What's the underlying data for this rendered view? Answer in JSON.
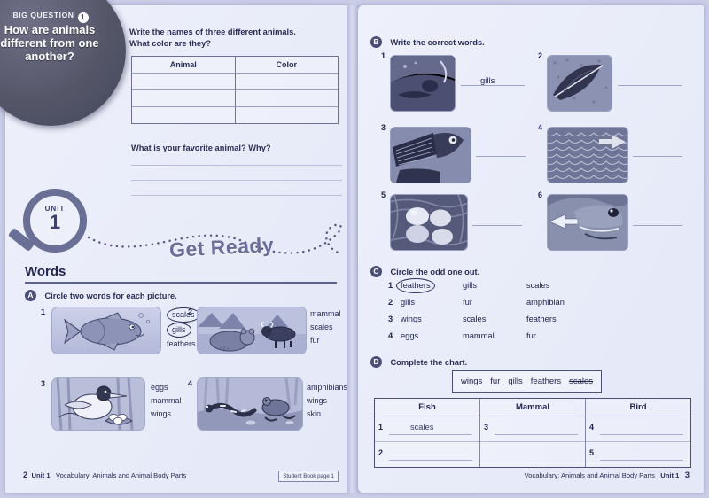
{
  "spread": {
    "left_page_number": "2",
    "right_page_number": "3",
    "footer_unit": "Unit 1",
    "footer_topic": "Vocabulary: Animals and Animal Body Parts",
    "student_book_badge": "Student Book page 1"
  },
  "big_question": {
    "label": "BIG QUESTION",
    "number": "1",
    "text": "How are animals different from one another?"
  },
  "opener": {
    "prompt_line1": "Write the names of three different animals.",
    "prompt_line2": "What color are they?",
    "table_headers": [
      "Animal",
      "Color"
    ],
    "table_rows": [
      [
        "",
        ""
      ],
      [
        "",
        ""
      ],
      [
        "",
        ""
      ]
    ],
    "favorite_prompt": "What is your favorite animal? Why?",
    "favorite_lines": [
      "",
      "",
      ""
    ]
  },
  "unit": {
    "label": "UNIT",
    "number": "1",
    "section_title": "Get Ready"
  },
  "words_section": {
    "heading": "Words"
  },
  "exercise_a": {
    "letter": "A",
    "instruction": "Circle two words for each picture.",
    "items": [
      {
        "number": "1",
        "picture": "fish-illustration",
        "options": [
          "scales",
          "gills",
          "feathers"
        ],
        "circled": [
          "scales",
          "gills"
        ]
      },
      {
        "number": "2",
        "picture": "bear-and-bison-illustration",
        "options": [
          "mammal",
          "scales",
          "fur"
        ],
        "circled": []
      },
      {
        "number": "3",
        "picture": "bird-with-nest-illustration",
        "options": [
          "eggs",
          "mammal",
          "wings"
        ],
        "circled": []
      },
      {
        "number": "4",
        "picture": "salamander-and-frog-illustration",
        "options": [
          "amphibians",
          "wings",
          "skin"
        ],
        "circled": []
      }
    ]
  },
  "exercise_b": {
    "letter": "B",
    "instruction": "Write the correct words.",
    "items": [
      {
        "number": "1",
        "photo": "fish-head-photo",
        "answer": "gills"
      },
      {
        "number": "2",
        "photo": "feather-photo",
        "answer": ""
      },
      {
        "number": "3",
        "photo": "bird-wing-photo",
        "answer": ""
      },
      {
        "number": "4",
        "photo": "fish-scales-photo",
        "answer": ""
      },
      {
        "number": "5",
        "photo": "eggs-in-nest-photo",
        "answer": ""
      },
      {
        "number": "6",
        "photo": "frog-photo",
        "answer": ""
      }
    ]
  },
  "exercise_c": {
    "letter": "C",
    "instruction": "Circle the odd one out.",
    "rows": [
      {
        "number": "1",
        "words": [
          "feathers",
          "gills",
          "scales"
        ],
        "circled": "feathers"
      },
      {
        "number": "2",
        "words": [
          "gills",
          "fur",
          "amphibian"
        ],
        "circled": ""
      },
      {
        "number": "3",
        "words": [
          "wings",
          "scales",
          "feathers"
        ],
        "circled": ""
      },
      {
        "number": "4",
        "words": [
          "eggs",
          "mammal",
          "fur"
        ],
        "circled": ""
      }
    ]
  },
  "exercise_d": {
    "letter": "D",
    "instruction": "Complete the chart.",
    "word_bank": [
      "wings",
      "fur",
      "gills",
      "feathers",
      "scales"
    ],
    "word_bank_used": [
      "scales"
    ],
    "columns": [
      "Fish",
      "Mammal",
      "Bird"
    ],
    "entries": [
      {
        "number": "1",
        "column": "Fish",
        "answer": "scales"
      },
      {
        "number": "2",
        "column": "Fish",
        "answer": ""
      },
      {
        "number": "3",
        "column": "Mammal",
        "answer": ""
      },
      {
        "number": "4",
        "column": "Bird",
        "answer": ""
      },
      {
        "number": "5",
        "column": "Bird",
        "answer": ""
      }
    ]
  },
  "colors": {
    "page_background": "#eef0fb",
    "ink": "#22264e",
    "accent": "#4b4f78",
    "rule": "#9fa5c6"
  }
}
